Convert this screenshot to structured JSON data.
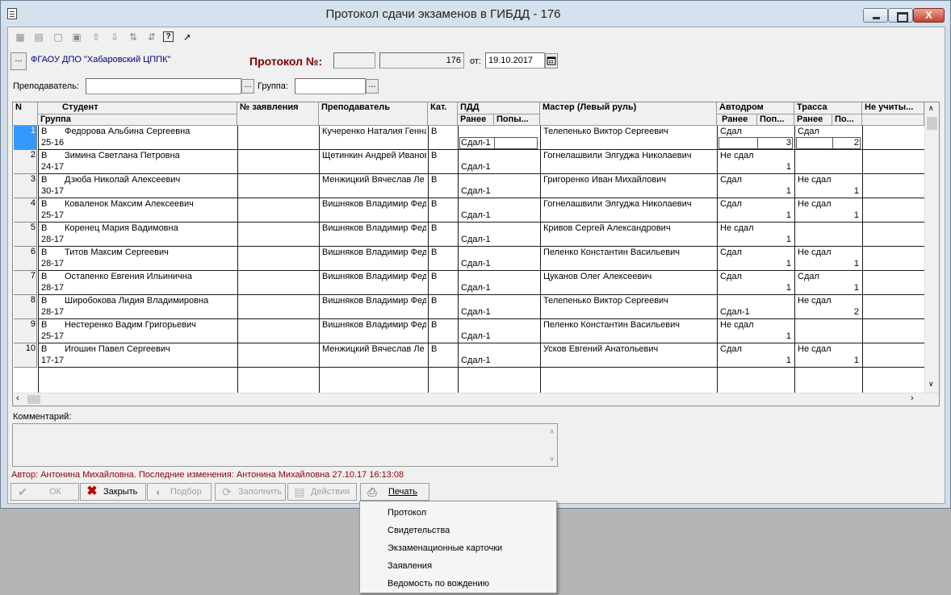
{
  "window": {
    "title": "Протокол сдачи экзаменов в ГИБДД  - 176",
    "close_glyph": "X"
  },
  "org": {
    "button_glyph": "...",
    "name": "ФГАОУ ДПО \"Хабаровский ЦППК\""
  },
  "protocol": {
    "label": "Протокол №:",
    "prefix": "",
    "number": "176",
    "date_label": "от:",
    "date": "19.10.2017"
  },
  "filters": {
    "teacher_label": "Преподаватель:",
    "teacher_value": "",
    "group_label": "Группа:",
    "group_value": "",
    "ellipsis": "..."
  },
  "colors": {
    "selection": "#3399ff",
    "author_text": "#8b0000",
    "protocol_label": "#800000"
  },
  "grid": {
    "headers": {
      "n": "N",
      "student": "Студент",
      "group": "Группа",
      "application": "№ заявления",
      "teacher": "Преподаватель",
      "cat": "Кат.",
      "pdd": "ПДД",
      "master": "Мастер (Левый руль)",
      "autodrom": "Автодром",
      "trassa": "Трасса",
      "not_counted": "Не учиты...",
      "earlier": "Ранее",
      "attempts": "Попы...",
      "attempts_short": "Поп...",
      "attempts_short2": "По..."
    },
    "rows": [
      {
        "n": "1",
        "cat": "B",
        "student": "Федорова Альбина Сергеевна",
        "group": "25-16",
        "app": "",
        "teacher": "Кучеренко Наталия Генна",
        "cat2": "B",
        "pdd_before": "",
        "pdd_result": "Сдал-1",
        "master": "Телепенько Виктор Сергеевич",
        "ad_status": "Сдал",
        "ad_result": "",
        "ad_attempts": "3",
        "tr_status": "Сдал",
        "tr_attempts": "2"
      },
      {
        "n": "2",
        "cat": "B",
        "student": "Зимина Светлана Петровна",
        "group": "24-17",
        "app": "",
        "teacher": "Щетинкин Андрей Иванов",
        "cat2": "B",
        "pdd_before": "",
        "pdd_result": "Сдал-1",
        "master": "Гогнелашвили Элгуджа Николаевич",
        "ad_status": "Не сдал",
        "ad_result": "",
        "ad_attempts": "1",
        "tr_status": "",
        "tr_attempts": ""
      },
      {
        "n": "3",
        "cat": "B",
        "student": "Дзюба Николай Алексеевич",
        "group": "30-17",
        "app": "",
        "teacher": "Менжицкий Вячеслав Ле",
        "cat2": "B",
        "pdd_before": "",
        "pdd_result": "Сдал-1",
        "master": "Григоренко Иван Михайлович",
        "ad_status": "Сдал",
        "ad_result": "",
        "ad_attempts": "1",
        "tr_status": "Не сдал",
        "tr_attempts": "1"
      },
      {
        "n": "4",
        "cat": "B",
        "student": "Коваленок Максим Алексеевич",
        "group": "25-17",
        "app": "",
        "teacher": "Вишняков Владимир Фед",
        "cat2": "B",
        "pdd_before": "",
        "pdd_result": "Сдал-1",
        "master": "Гогнелашвили Элгуджа Николаевич",
        "ad_status": "Сдал",
        "ad_result": "",
        "ad_attempts": "1",
        "tr_status": "Не сдал",
        "tr_attempts": "1"
      },
      {
        "n": "5",
        "cat": "B",
        "student": "Коренец Мария Вадимовна",
        "group": "28-17",
        "app": "",
        "teacher": "Вишняков Владимир Фед",
        "cat2": "B",
        "pdd_before": "",
        "pdd_result": "Сдал-1",
        "master": "Кривов Сергей Александрович",
        "ad_status": "Не сдал",
        "ad_result": "",
        "ad_attempts": "1",
        "tr_status": "",
        "tr_attempts": ""
      },
      {
        "n": "6",
        "cat": "B",
        "student": "Титов Максим Сергеевич",
        "group": "28-17",
        "app": "",
        "teacher": "Вишняков Владимир Фед",
        "cat2": "B",
        "pdd_before": "",
        "pdd_result": "Сдал-1",
        "master": "Пеленко Константин Васильевич",
        "ad_status": "Сдал",
        "ad_result": "",
        "ad_attempts": "1",
        "tr_status": "Не сдал",
        "tr_attempts": "1"
      },
      {
        "n": "7",
        "cat": "B",
        "student": "Остапенко Евгения Ильинична",
        "group": "28-17",
        "app": "",
        "teacher": "Вишняков Владимир Фед",
        "cat2": "B",
        "pdd_before": "",
        "pdd_result": "Сдал-1",
        "master": "Цуканов Олег Алексеевич",
        "ad_status": "Сдал",
        "ad_result": "",
        "ad_attempts": "1",
        "tr_status": "Сдал",
        "tr_attempts": "1"
      },
      {
        "n": "8",
        "cat": "B",
        "student": "Широбокова Лидия Владимировна",
        "group": "28-17",
        "app": "",
        "teacher": "Вишняков Владимир Фед",
        "cat2": "B",
        "pdd_before": "",
        "pdd_result": "Сдал-1",
        "master": "Телепенько Виктор Сергеевич",
        "ad_status": "",
        "ad_result": "Сдал-1",
        "ad_attempts": "",
        "tr_status": "Не сдал",
        "tr_attempts": "2"
      },
      {
        "n": "9",
        "cat": "B",
        "student": "Нестеренко Вадим Григорьевич",
        "group": "25-17",
        "app": "",
        "teacher": "Вишняков Владимир Фед",
        "cat2": "B",
        "pdd_before": "",
        "pdd_result": "Сдал-1",
        "master": "Пеленко Константин Васильевич",
        "ad_status": "Не сдал",
        "ad_result": "",
        "ad_attempts": "1",
        "tr_status": "",
        "tr_attempts": ""
      },
      {
        "n": "10",
        "cat": "B",
        "student": "Игошин Павел Сергеевич",
        "group": "17-17",
        "app": "",
        "teacher": "Менжицкий Вячеслав Ле",
        "cat2": "B",
        "pdd_before": "",
        "pdd_result": "Сдал-1",
        "master": "Усков Евгений  Анатольевич",
        "ad_status": "Сдал",
        "ad_result": "",
        "ad_attempts": "1",
        "tr_status": "Не сдал",
        "tr_attempts": "1"
      }
    ]
  },
  "comment": {
    "label": "Комментарий:",
    "value": ""
  },
  "author": "Автор: Антонина Михайловна. Последние изменения: Антонина Михайловна 27.10.17 16:13:08",
  "buttons": {
    "ok": "ОК",
    "close": "Закрыть",
    "pick": "Подбор",
    "fill": "Заполнить",
    "actions": "Действия",
    "print": "Печать"
  },
  "print_menu": [
    "Протокол",
    "Свидетельства",
    "Экзаменационные карточки",
    "Заявления",
    "Ведомость по вождению"
  ],
  "icons": [
    "document-icon",
    "table-add-icon",
    "table-edit-icon",
    "table-delete-icon",
    "table-copy-icon",
    "arrow-up-icon",
    "arrow-down-icon",
    "sort-az-icon",
    "sort-za-icon",
    "help-icon",
    "pointer-help-icon"
  ]
}
